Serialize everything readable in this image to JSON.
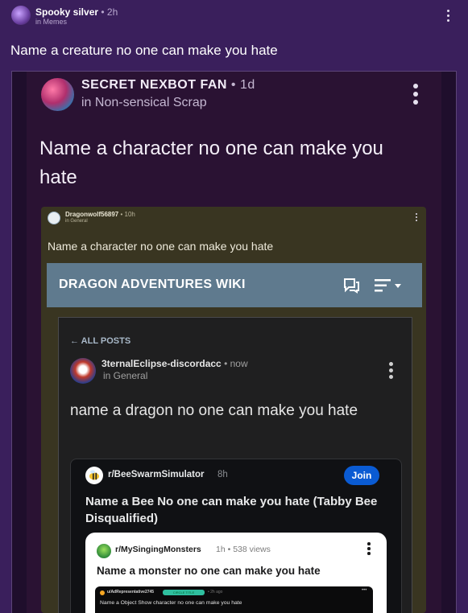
{
  "post": {
    "author": "Spooky silver",
    "time": "• 2h",
    "category": "in Memes",
    "title": "Name a creature no one can make you hate"
  },
  "embed1": {
    "author": "SECRET NEXBOT FAN",
    "time": "• 1d",
    "category": "in Non-sensical Scrap",
    "title": "Name a character no one can make you hate"
  },
  "embed2": {
    "author": "Dragonwolf56897",
    "time": "• 10h",
    "category": "in General",
    "title": "Name a character no one can make you hate"
  },
  "wiki": {
    "title": "DRAGON ADVENTURES WIKI",
    "back_label": "ALL POSTS",
    "author": "3ternalEclipse-discordacc",
    "time": "• now",
    "category": "in General",
    "title_post": "name a dragon no one can make you hate"
  },
  "reddit1": {
    "subreddit": "r/BeeSwarmSimulator",
    "time": "8h",
    "join_label": "Join",
    "title": "Name a Bee No one can make you hate (Tabby Bee Disqualified)"
  },
  "reddit2": {
    "subreddit": "r/MySingingMonsters",
    "meta": "1h • 538 views",
    "title": "Name a monster no one can make you hate"
  },
  "reddit3": {
    "subreddit": "u/AdRepresentative2745",
    "flair": "CIRCLE TITLE",
    "time": "• 2h ago",
    "title": "Name a Object Show character no one can make you hate"
  },
  "colors": {
    "page_bg": "#3a1f5c",
    "wiki_bar": "#5f7a8e",
    "join_button": "#0a5bd3"
  },
  "icons": [
    "more-vertical-icon",
    "back-arrow-icon",
    "chat-icon",
    "menu-icon"
  ]
}
